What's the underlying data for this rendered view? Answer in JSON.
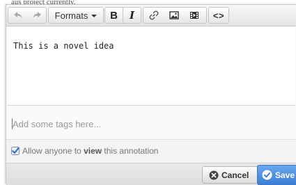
{
  "background_text": "aus project currently.",
  "toolbar": {
    "formats_label": "Formats",
    "bold_label": "B",
    "italic_label": "I",
    "code_label": "<>",
    "icons": [
      "undo-icon",
      "redo-icon",
      "chevron-down-icon",
      "link-icon",
      "image-icon",
      "video-icon"
    ]
  },
  "editor": {
    "content": "This is a novel idea"
  },
  "tags": {
    "placeholder": "Add some tags here..."
  },
  "permission": {
    "checked": true,
    "text_before": "Allow anyone to ",
    "text_strong": "view",
    "text_after": " this annotation"
  },
  "buttons": {
    "cancel_label": "Cancel",
    "save_label": "Save"
  },
  "colors": {
    "save_button": "#3b7fd6",
    "checkbox": "#3a6fc4",
    "cancel_icon": "#444444"
  }
}
